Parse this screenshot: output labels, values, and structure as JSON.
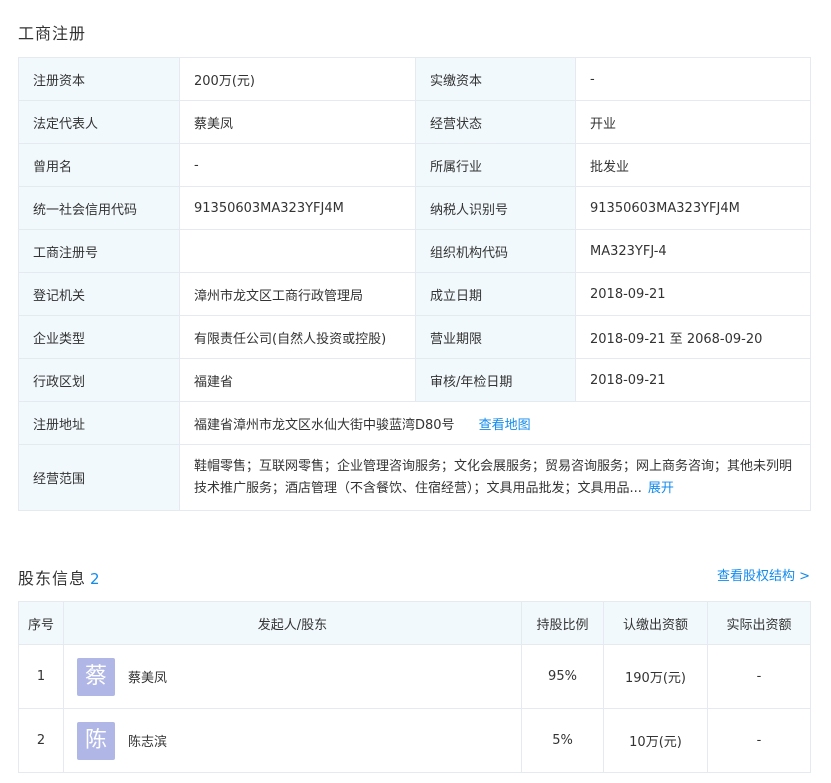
{
  "registration": {
    "title": "工商注册",
    "rows": [
      {
        "l1": "注册资本",
        "v1": "200万(元)",
        "l2": "实缴资本",
        "v2": "-"
      },
      {
        "l1": "法定代表人",
        "v1": "蔡美凤",
        "l2": "经营状态",
        "v2": "开业"
      },
      {
        "l1": "曾用名",
        "v1": "-",
        "l2": "所属行业",
        "v2": "批发业"
      },
      {
        "l1": "统一社会信用代码",
        "v1": "91350603MA323YFJ4M",
        "l2": "纳税人识别号",
        "v2": "91350603MA323YFJ4M"
      },
      {
        "l1": "工商注册号",
        "v1": "",
        "l2": "组织机构代码",
        "v2": "MA323YFJ-4"
      },
      {
        "l1": "登记机关",
        "v1": "漳州市龙文区工商行政管理局",
        "l2": "成立日期",
        "v2": "2018-09-21"
      },
      {
        "l1": "企业类型",
        "v1": "有限责任公司(自然人投资或控股)",
        "l2": "营业期限",
        "v2": "2018-09-21 至 2068-09-20"
      },
      {
        "l1": "行政区划",
        "v1": "福建省",
        "l2": "审核/年检日期",
        "v2": "2018-09-21"
      }
    ],
    "address": {
      "label": "注册地址",
      "value": "福建省漳州市龙文区水仙大街中骏蓝湾D80号",
      "link": "查看地图"
    },
    "scope": {
      "label": "经营范围",
      "value": "鞋帽零售；互联网零售；企业管理咨询服务；文化会展服务；贸易咨询服务；网上商务咨询；其他未列明技术推广服务；酒店管理（不含餐饮、住宿经营）；文具用品批发；文具用品...",
      "link": "展开"
    }
  },
  "shareholders": {
    "title": "股东信息",
    "count": "2",
    "structure_link": "查看股权结构 >",
    "headers": {
      "index": "序号",
      "name": "发起人/股东",
      "ratio": "持股比例",
      "subscribed": "认缴出资额",
      "paid": "实际出资额"
    },
    "rows": [
      {
        "index": "1",
        "avatar": "蔡",
        "name": "蔡美凤",
        "ratio": "95%",
        "subscribed": "190万(元)",
        "paid": "-"
      },
      {
        "index": "2",
        "avatar": "陈",
        "name": "陈志滨",
        "ratio": "5%",
        "subscribed": "10万(元)",
        "paid": "-"
      }
    ]
  }
}
